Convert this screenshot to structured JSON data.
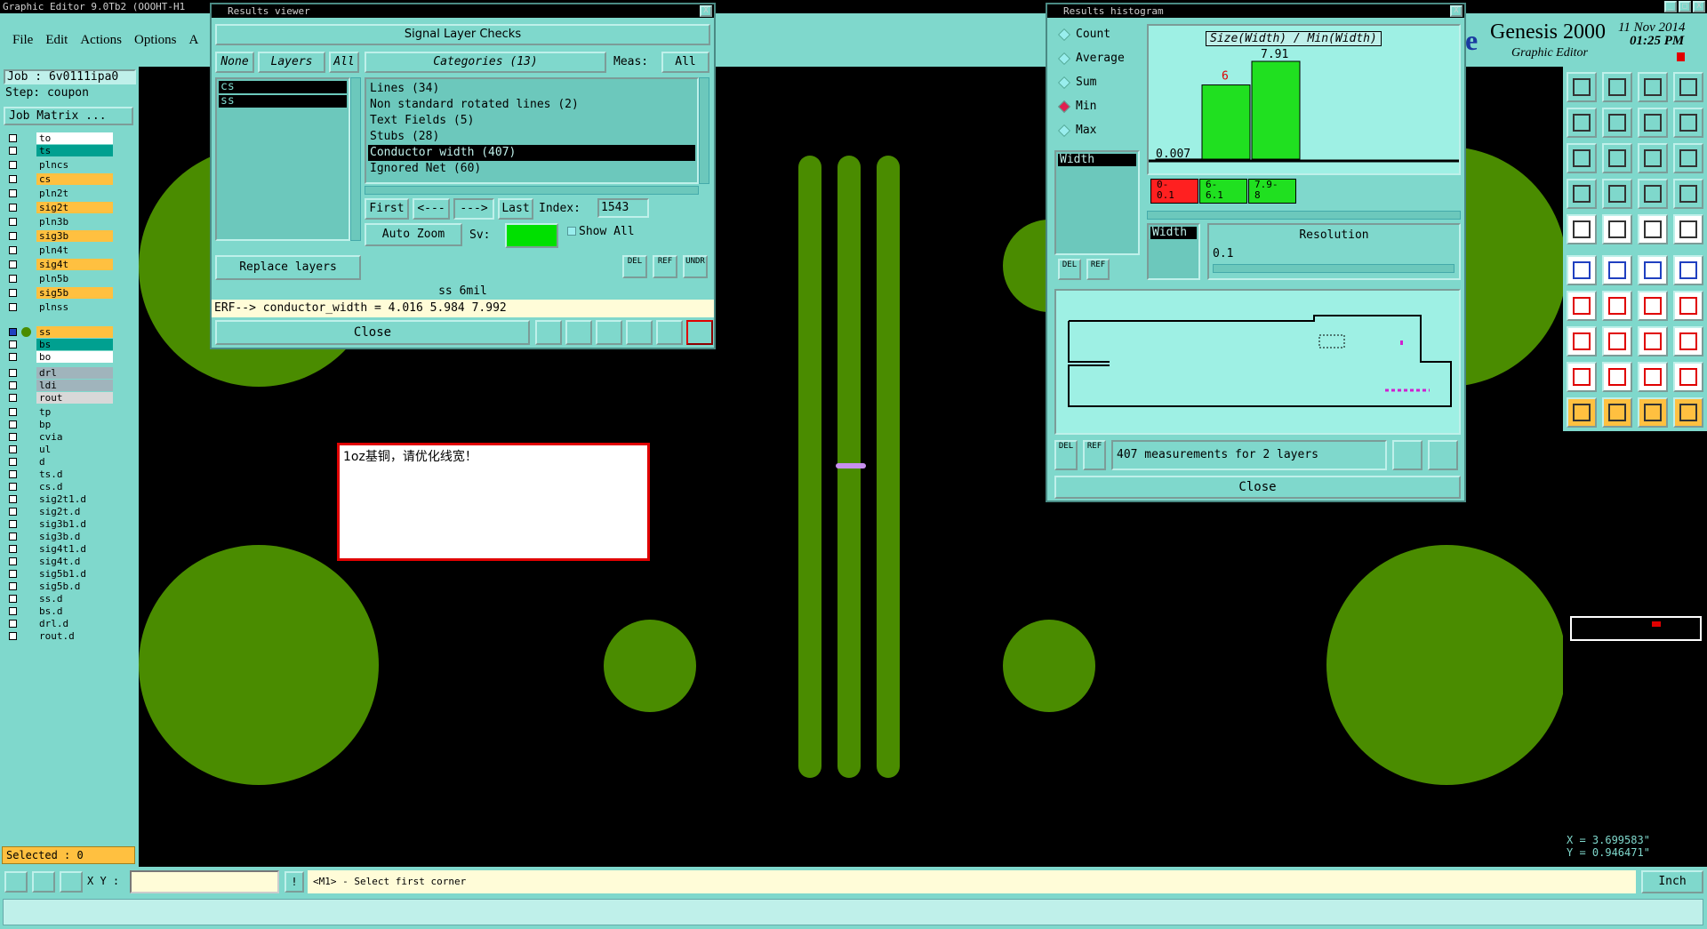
{
  "app": {
    "title": "Graphic Editor 9.0Tb2 (OOOHT-H1",
    "brand_name": "Genesis 2000",
    "brand_sub": "Graphic Editor",
    "brand_partial": "e",
    "date": "11 Nov 2014",
    "time": "01:25 PM",
    "win_buttons": [
      "_",
      "□",
      "X"
    ]
  },
  "menu": [
    "File",
    "Edit",
    "Actions",
    "Options",
    "A"
  ],
  "job": {
    "label": "Job : 6v0111ipa0",
    "step": "Step: coupon",
    "matrix_btn": "Job Matrix ..."
  },
  "layers": [
    {
      "name": "to",
      "color": "#ffffff"
    },
    {
      "name": "ts",
      "color": "#00a090"
    },
    {
      "name": "plncs",
      "color": "#7fd8cc"
    },
    {
      "name": "cs",
      "color": "#ffc040"
    },
    {
      "name": "pln2t",
      "color": "#7fd8cc"
    },
    {
      "name": "sig2t",
      "color": "#ffc040"
    },
    {
      "name": "pln3b",
      "color": "#7fd8cc"
    },
    {
      "name": "sig3b",
      "color": "#ffc040"
    },
    {
      "name": "pln4t",
      "color": "#7fd8cc"
    },
    {
      "name": "sig4t",
      "color": "#ffc040"
    },
    {
      "name": "pln5b",
      "color": "#7fd8cc"
    },
    {
      "name": "sig5b",
      "color": "#ffc040"
    },
    {
      "name": "plnss",
      "color": "#7fd8cc"
    },
    {
      "name": "ss",
      "color": "#ffc040",
      "active": true
    },
    {
      "name": "bs",
      "color": "#00a090"
    },
    {
      "name": "bo",
      "color": "#ffffff"
    },
    {
      "name": "drl",
      "color": "#a0b4bc"
    },
    {
      "name": "ldi",
      "color": "#a0b4bc"
    },
    {
      "name": "rout",
      "color": "#d8d8d8"
    },
    {
      "name": "tp",
      "color": "#7fd8cc"
    },
    {
      "name": "bp",
      "color": "#7fd8cc"
    },
    {
      "name": "cvia",
      "color": "#7fd8cc"
    },
    {
      "name": "ul",
      "color": "#7fd8cc"
    },
    {
      "name": "d",
      "color": "#7fd8cc"
    },
    {
      "name": "ts.d",
      "color": "#7fd8cc"
    },
    {
      "name": "cs.d",
      "color": "#7fd8cc"
    },
    {
      "name": "sig2t1.d",
      "color": "#7fd8cc"
    },
    {
      "name": "sig2t.d",
      "color": "#7fd8cc"
    },
    {
      "name": "sig3b1.d",
      "color": "#7fd8cc"
    },
    {
      "name": "sig3b.d",
      "color": "#7fd8cc"
    },
    {
      "name": "sig4t1.d",
      "color": "#7fd8cc"
    },
    {
      "name": "sig4t.d",
      "color": "#7fd8cc"
    },
    {
      "name": "sig5b1.d",
      "color": "#7fd8cc"
    },
    {
      "name": "sig5b.d",
      "color": "#7fd8cc"
    },
    {
      "name": "ss.d",
      "color": "#7fd8cc"
    },
    {
      "name": "bs.d",
      "color": "#7fd8cc"
    },
    {
      "name": "drl.d",
      "color": "#7fd8cc"
    },
    {
      "name": "rout.d",
      "color": "#7fd8cc"
    }
  ],
  "selected": "Selected : 0",
  "results_viewer": {
    "title": "Results viewer",
    "header": "Signal Layer Checks",
    "none_btn": "None",
    "layers_btn": "Layers",
    "all_btn": "All",
    "layer_list": [
      "cs",
      "ss"
    ],
    "categories_label": "Categories (13)",
    "meas_label": "Meas:",
    "meas_value": "All",
    "categories": [
      "Lines (34)",
      "Non standard rotated lines (2)",
      "Text Fields (5)",
      "Stubs (28)",
      "Conductor width (407)",
      "Ignored Net (60)"
    ],
    "selected_category": 4,
    "first": "First",
    "prev": "<---",
    "next": "--->",
    "last": "Last",
    "index_label": "Index:",
    "index_value": "1543",
    "auto_zoom": "Auto Zoom",
    "sv_label": "Sv:",
    "show_all": "Show All",
    "replace_layers": "Replace layers",
    "del": "DEL",
    "ref": "REF",
    "undr": "UNDR",
    "status": "ss 6mil",
    "erf": "ERF--> conductor_width = 4.016 5.984 7.992",
    "close": "Close"
  },
  "note": {
    "text": "1oz基铜，请优化线宽！"
  },
  "histogram": {
    "title": "Results histogram",
    "options": [
      "Count",
      "Average",
      "Sum",
      "Min",
      "Max"
    ],
    "selected_option": "Min",
    "chart_title": "Size(Width) / Min(Width)",
    "bar_labels": [
      "6",
      "7.91"
    ],
    "min_label": "0.007",
    "bins": [
      "0-\n0.1",
      "6-\n6.1",
      "7.9-\n8"
    ],
    "bin_colors": [
      "#ff2020",
      "#20e020",
      "#20e020"
    ],
    "list_item": "Width",
    "list_item2": "Width",
    "resolution_label": "Resolution",
    "resolution_value": "0.1",
    "del": "DEL",
    "ref": "REF",
    "measurements": "407 measurements for 2 layers",
    "close": "Close"
  },
  "chart_data": {
    "type": "bar",
    "title": "Size(Width) / Min(Width)",
    "categories": [
      "0-0.1",
      "6-6.1",
      "7.9-8"
    ],
    "values": [
      0.007,
      6,
      7.91
    ],
    "xlabel": "",
    "ylabel": ""
  },
  "status_bar": {
    "xy_label": "X Y :",
    "xy_value": "",
    "prompt": "<M1> - Select first corner",
    "units": "Inch",
    "coord_x": "X = 3.699583\"",
    "coord_y": "Y = 0.946471\""
  }
}
